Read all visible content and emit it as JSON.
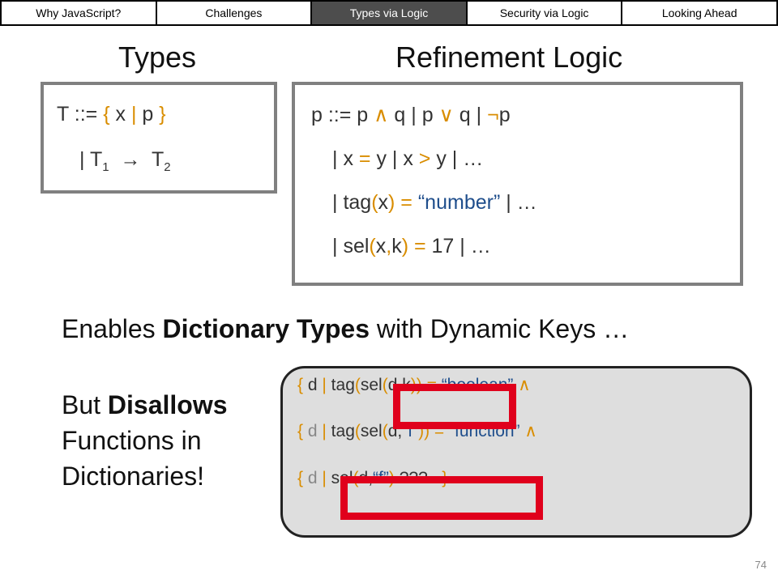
{
  "nav": {
    "items": [
      {
        "label": "Why JavaScript?"
      },
      {
        "label": "Challenges"
      },
      {
        "label": "Types via Logic"
      },
      {
        "label": "Security via Logic"
      },
      {
        "label": "Looking Ahead"
      }
    ],
    "active_index": 2
  },
  "headings": {
    "types": "Types",
    "refinement": "Refinement Logic"
  },
  "types_box": {
    "line1": {
      "t": "T ::= ",
      "lbrace": "{",
      "x": " x ",
      "bar": "|",
      "p": " p ",
      "rbrace": "}"
    },
    "line2": {
      "bar": "| ",
      "t1": "T",
      "sub1": "1",
      "arrow": "  →  ",
      "t2": "T",
      "sub2": "2"
    }
  },
  "logic_box": {
    "line1": {
      "a": "p ::= p ",
      "and": "∧",
      "b": " q | p ",
      "or": "∨",
      "c": " q | ",
      "not": "¬",
      "d": "p"
    },
    "line2": {
      "a": "| x ",
      "eq": "=",
      "b": " y | x ",
      "gt": ">",
      "c": " y | …"
    },
    "line3": {
      "a": "| tag",
      "lp": "(",
      "x": "x",
      "rp": ")",
      "eq": " = ",
      "str": "“number”",
      "c": " | …"
    },
    "line4": {
      "a": "| sel",
      "lp": "(",
      "x": "x",
      "comma": ",",
      "k": "k",
      "rp": ")",
      "eq": " = ",
      "c": "17 | …"
    }
  },
  "enables_text": {
    "pre": "Enables ",
    "bold": "Dictionary Types",
    "post": " with Dynamic Keys …"
  },
  "disallows_text": {
    "pre": "But ",
    "bold": "Disallows",
    "line2": "Functions in",
    "line3": "Dictionaries!"
  },
  "dict_box": {
    "line1": {
      "lb": "{",
      "d": " d ",
      "bar": "|",
      "tag": " tag",
      "lp": "(",
      "sel": "sel",
      "lp2": "(",
      "dk": "d,k",
      "rp": "))",
      "eq": " = ",
      "str": "“boolean”",
      "and": " ∧"
    },
    "line2": {
      "lb": "{",
      "d": " d ",
      "bar": "|",
      "tag": " tag",
      "lp": "(",
      "sel": "sel",
      "lp2": "(",
      "dk": "d,",
      "f": "“f”",
      "rp": "))",
      "eq": " = ",
      "str": "“function”",
      "and": " ∧"
    },
    "line3": {
      "lb": "{",
      "d": " d ",
      "bar": "|",
      "sel": " sel",
      "lp": "(",
      "dk": "d,",
      "f": "“f”",
      "rp": ")",
      "q": " ???",
      "rb": "   }"
    }
  },
  "page_number": "74",
  "colors": {
    "accent_orange": "#d98d00",
    "accent_blue": "#1f4e8c",
    "highlight_red": "#e0001c",
    "active_tab": "#4d4d4d"
  }
}
